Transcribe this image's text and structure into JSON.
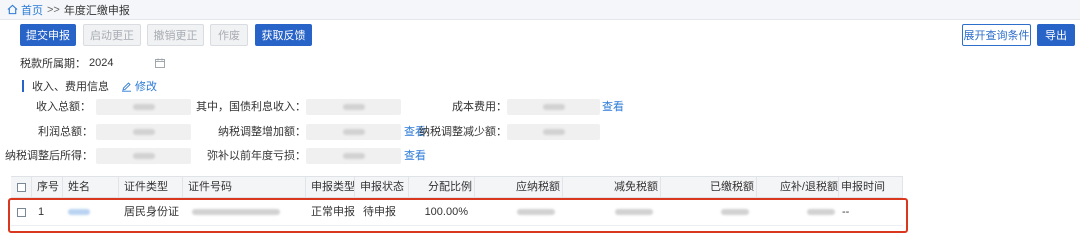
{
  "breadcrumb": {
    "home": "首页",
    "separator": ">>",
    "current": "年度汇缴申报"
  },
  "toolbar": {
    "submit": "提交申报",
    "start_correction": "启动更正",
    "cancel_correction": "撤销更正",
    "void": "作废",
    "feedback": "获取反馈",
    "expand_query": "展开查询条件",
    "export": "导出"
  },
  "tax_period": {
    "label": "税款所属期：",
    "value": "2024"
  },
  "income_section": {
    "title": "收入、费用信息",
    "edit": "修改",
    "view": "查看",
    "fields": {
      "total_income": "收入总额：",
      "bond_interest": "其中，国债利息收入：",
      "cost": "成本费用：",
      "total_profit": "利润总额：",
      "tax_increase": "纳税调整增加额：",
      "tax_decrease": "纳税调整减少额：",
      "adjusted_income": "纳税调整后所得：",
      "loss_offset": "弥补以前年度亏损："
    }
  },
  "table": {
    "columns": [
      "序号",
      "姓名",
      "证件类型",
      "证件号码",
      "申报类型",
      "申报状态",
      "分配比例",
      "应纳税额",
      "减免税额",
      "已缴税额",
      "应补/退税额",
      "申报时间"
    ],
    "rows": [
      {
        "index": "1",
        "id_type": "居民身份证",
        "declaration_type": "正常申报",
        "status": "待申报",
        "ratio": "100.00%",
        "declared_time": "--"
      }
    ]
  },
  "colors": {
    "primary": "#2863c8",
    "link": "#2d7bd6",
    "highlight": "#d9381e"
  }
}
